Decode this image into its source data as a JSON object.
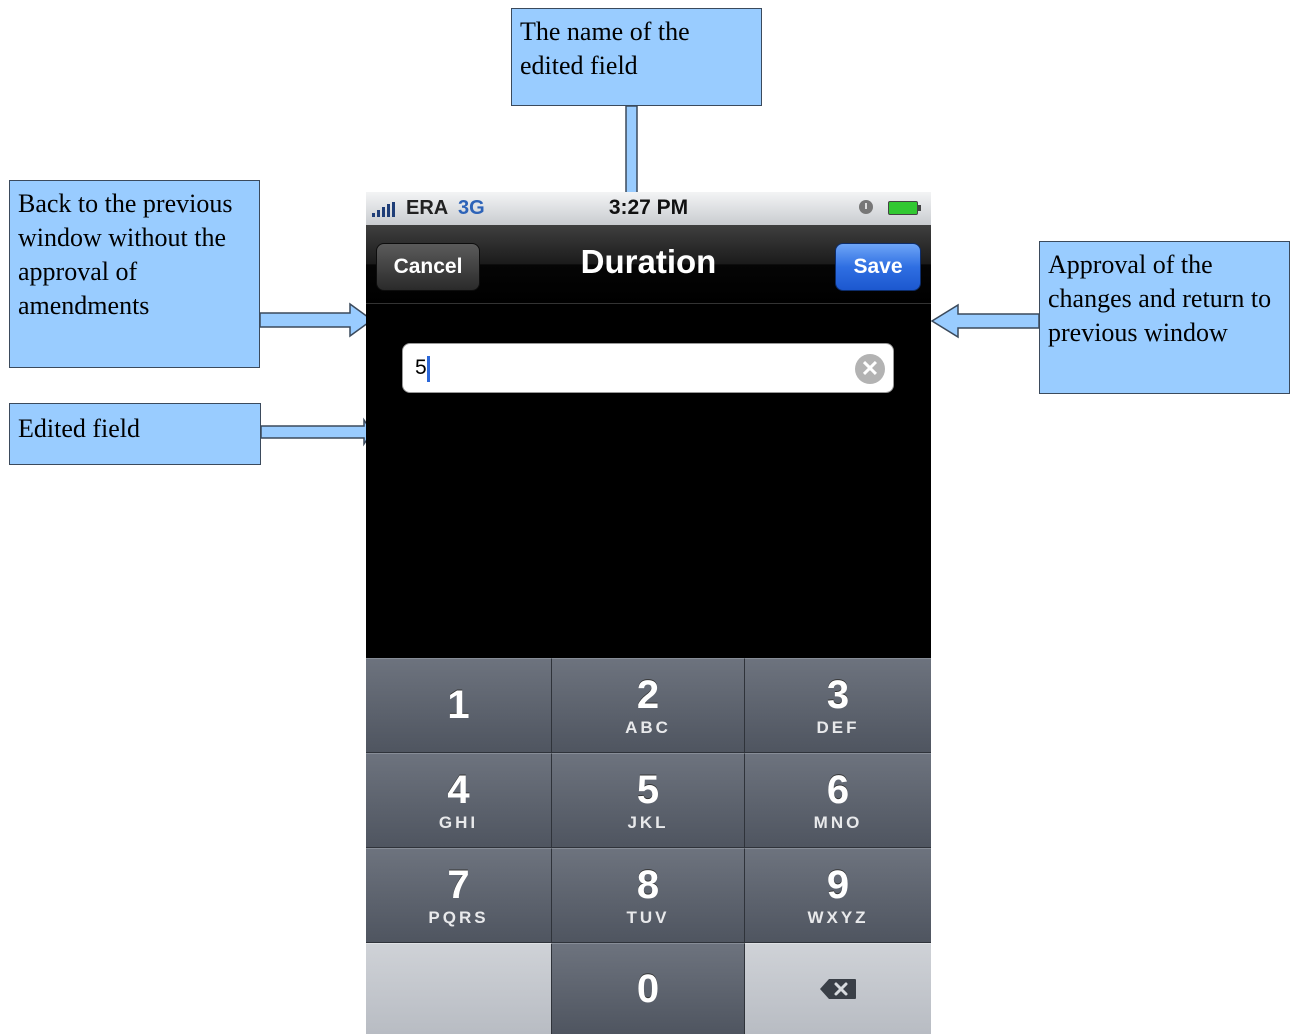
{
  "annotations": {
    "title_callout": "The name of the edited field",
    "cancel_callout": "Back to the previous window without the approval of amendments",
    "save_callout": "Approval of the changes and return to previous window",
    "field_callout": "Edited field"
  },
  "status_bar": {
    "carrier": "ERA",
    "network": "3G",
    "time": "3:27 PM",
    "icons": [
      "signal-icon",
      "alarm-icon",
      "battery-icon"
    ]
  },
  "nav": {
    "title": "Duration",
    "cancel_label": "Cancel",
    "save_label": "Save"
  },
  "input": {
    "value": "5",
    "clear_icon": "clear-icon"
  },
  "keypad": {
    "keys": [
      {
        "digit": "1",
        "letters": ""
      },
      {
        "digit": "2",
        "letters": "ABC"
      },
      {
        "digit": "3",
        "letters": "DEF"
      },
      {
        "digit": "4",
        "letters": "GHI"
      },
      {
        "digit": "5",
        "letters": "JKL"
      },
      {
        "digit": "6",
        "letters": "MNO"
      },
      {
        "digit": "7",
        "letters": "PQRS"
      },
      {
        "digit": "8",
        "letters": "TUV"
      },
      {
        "digit": "9",
        "letters": "WXYZ"
      },
      {
        "digit": "0",
        "letters": ""
      }
    ],
    "backspace_icon": "backspace-icon"
  },
  "colors": {
    "callout_fill": "#99ccff",
    "save_button": "#2f6fe2",
    "keypad_key": "#5d636d"
  }
}
